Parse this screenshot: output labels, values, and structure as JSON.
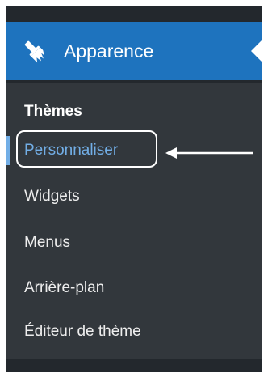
{
  "header": {
    "label": "Apparence",
    "icon": "paintbrush-icon",
    "background_color": "#1e73be"
  },
  "submenu": {
    "items": [
      {
        "label": "Thèmes",
        "state": "current"
      },
      {
        "label": "Personnaliser",
        "state": "highlighted"
      },
      {
        "label": "Widgets",
        "state": "normal"
      },
      {
        "label": "Menus",
        "state": "normal"
      },
      {
        "label": "Arrière-plan",
        "state": "normal"
      },
      {
        "label": "Éditeur de thème",
        "state": "normal"
      }
    ],
    "active_color": "#72aee6"
  },
  "annotation": {
    "type": "arrow-left",
    "color": "#ffffff"
  }
}
